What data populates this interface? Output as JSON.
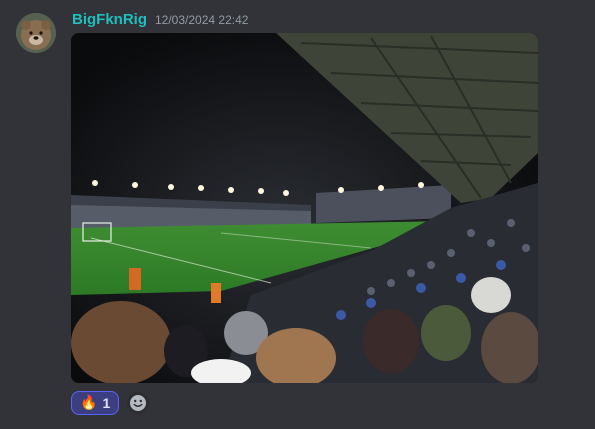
{
  "message": {
    "username": "BigFknRig",
    "timestamp": "12/03/2024 22:42",
    "username_color": "#1fbfbd",
    "avatar_icon": "bear-avatar",
    "attachment_icon": "stadium-photo"
  },
  "reactions": [
    {
      "emoji": "🔥",
      "emoji_name": "fire-icon",
      "count": "1"
    }
  ],
  "add_reaction_icon": "smiley-add-reaction-icon",
  "colors": {
    "background": "#313338",
    "reaction_bg": "#3b3f82",
    "reaction_border": "#5865f2",
    "timestamp": "#949ba4"
  }
}
